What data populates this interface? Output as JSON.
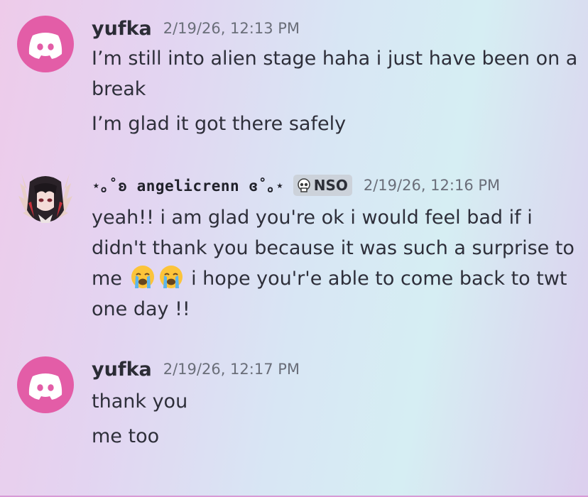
{
  "messages": [
    {
      "username": "yufka",
      "timestamp": "2/19/26, 12:13 PM",
      "avatar_icon": "discord-logo-icon",
      "lines": [
        "I’m still into alien stage haha i just have been on a break",
        "I’m glad it got there safely"
      ]
    },
    {
      "username": "⋆｡˚ʚ angelicrenn ɞ˚｡⋆",
      "tag_label": "NSO",
      "tag_icon": "skull-icon",
      "timestamp": "2/19/26, 12:16 PM",
      "avatar_icon": "anime-character-avatar",
      "text_part1": "yeah!! i am glad you're ok i would feel bad if i didn't thank you because it was such a surprise to me",
      "emoji_icon": "loudly-crying-face-icon",
      "text_part2": " i hope you'r'e able to come back to twt one day !!"
    },
    {
      "username": "yufka",
      "timestamp": "2/19/26, 12:17 PM",
      "avatar_icon": "discord-logo-icon",
      "lines": [
        "thank you",
        "me too"
      ]
    }
  ],
  "colors": {
    "discord_avatar_bg": "#e35da7",
    "tag_bg": "#ccd2da",
    "timestamp": "#6a6e79",
    "bottom_line": "#d89ad6"
  }
}
